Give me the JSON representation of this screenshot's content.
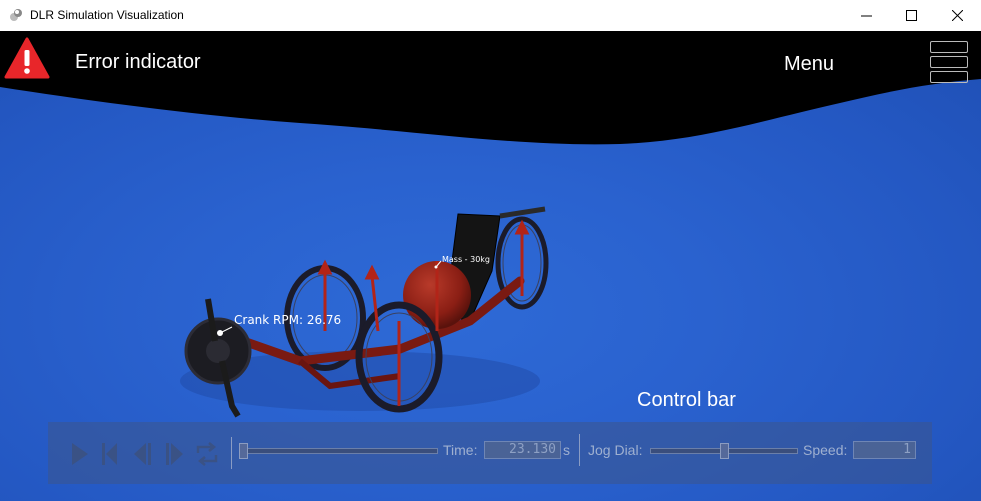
{
  "window": {
    "title": "DLR Simulation Visualization",
    "controls": [
      "minimize-icon",
      "maximize-icon",
      "close-icon"
    ]
  },
  "overlay": {
    "error_label": "Error indicator",
    "menu_label": "Menu",
    "control_bar_label": "Control bar"
  },
  "scene": {
    "annotations": {
      "crank": "Crank RPM: 26.76",
      "mass": "Mass - 30kg"
    }
  },
  "control_bar": {
    "buttons": [
      "play-icon",
      "step-back-icon",
      "frame-back-icon",
      "frame-forward-icon",
      "loop-icon"
    ],
    "time_label": "Time:",
    "time_value": "23.130",
    "time_unit": "s",
    "jog_label": "Jog Dial:",
    "speed_label": "Speed:",
    "speed_value": "1"
  },
  "colors": {
    "background_blue": "#2a62cf",
    "error_red": "#e8262a",
    "bike_frame": "#7a1a12"
  }
}
